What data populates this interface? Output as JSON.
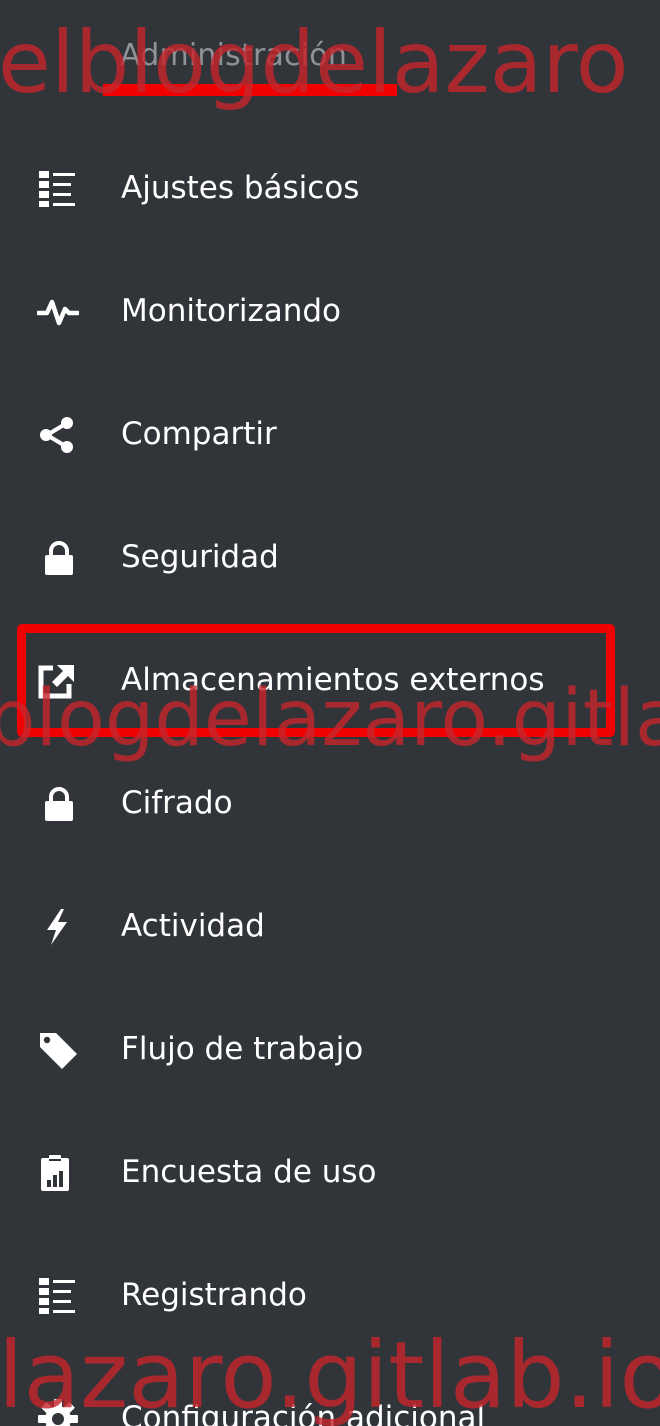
{
  "section": {
    "title": "Administración"
  },
  "menu": {
    "items": [
      {
        "label": "Ajustes básicos",
        "icon": "list-icon"
      },
      {
        "label": "Monitorizando",
        "icon": "activity-pulse-icon"
      },
      {
        "label": "Compartir",
        "icon": "share-icon"
      },
      {
        "label": "Seguridad",
        "icon": "lock-icon"
      },
      {
        "label": "Almacenamientos externos",
        "icon": "external-link-icon",
        "highlighted": true
      },
      {
        "label": "Cifrado",
        "icon": "lock-icon"
      },
      {
        "label": "Actividad",
        "icon": "lightning-icon"
      },
      {
        "label": "Flujo de trabajo",
        "icon": "tag-icon"
      },
      {
        "label": "Encuesta de uso",
        "icon": "clipboard-chart-icon"
      },
      {
        "label": "Registrando",
        "icon": "list-icon"
      },
      {
        "label": "Configuración adicional",
        "icon": "gear-icon"
      }
    ]
  },
  "watermarks": {
    "top": "elblogdelazaro",
    "middle": "blogdelazaro.gitla",
    "bottom": "lazaro.gitlab.io"
  },
  "colors": {
    "background": "#31353a",
    "text": "#ffffff",
    "header_text": "#8f9296",
    "annotation_red": "#f00000",
    "watermark": "#c4262c"
  }
}
